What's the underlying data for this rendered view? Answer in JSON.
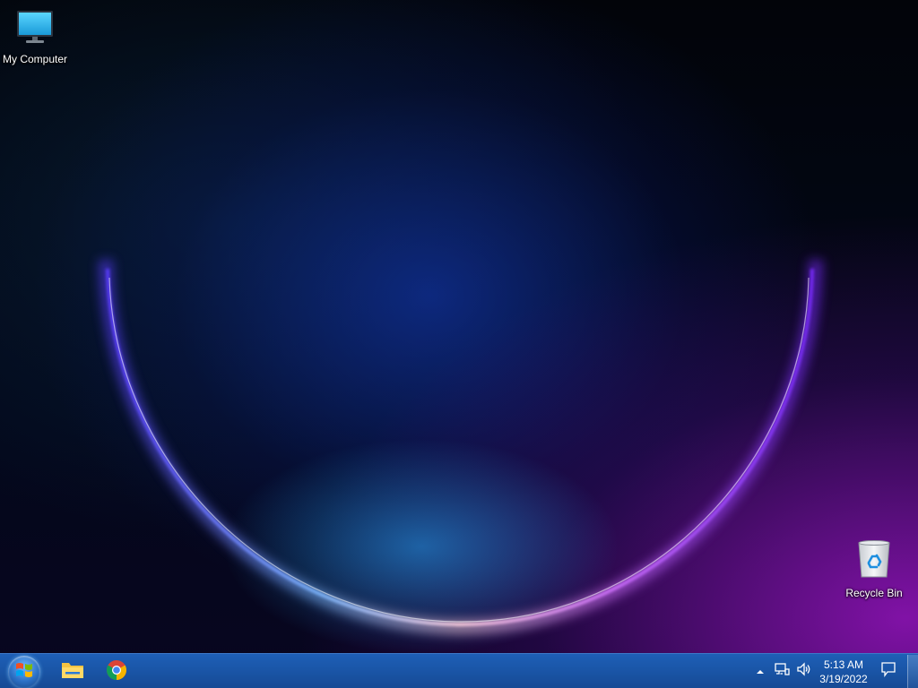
{
  "desktop": {
    "icons": [
      {
        "label": "My Computer",
        "icon": "monitor-icon"
      },
      {
        "label": "Recycle Bin",
        "icon": "recycle-bin-icon"
      }
    ]
  },
  "taskbar": {
    "start_icon": "windows-logo-icon",
    "pinned": [
      {
        "icon": "file-explorer-icon"
      },
      {
        "icon": "chrome-icon"
      }
    ],
    "tray": {
      "overflow_icon": "chevron-up-icon",
      "network_icon": "network-icon",
      "volume_icon": "speaker-icon",
      "time": "5:13 AM",
      "date": "3/19/2022",
      "notification_icon": "action-center-icon"
    }
  },
  "colors": {
    "taskbar": "#1a56a8",
    "wallpaper_accent_blue": "#1e90ff",
    "wallpaper_accent_purple": "#9a1ec8"
  }
}
